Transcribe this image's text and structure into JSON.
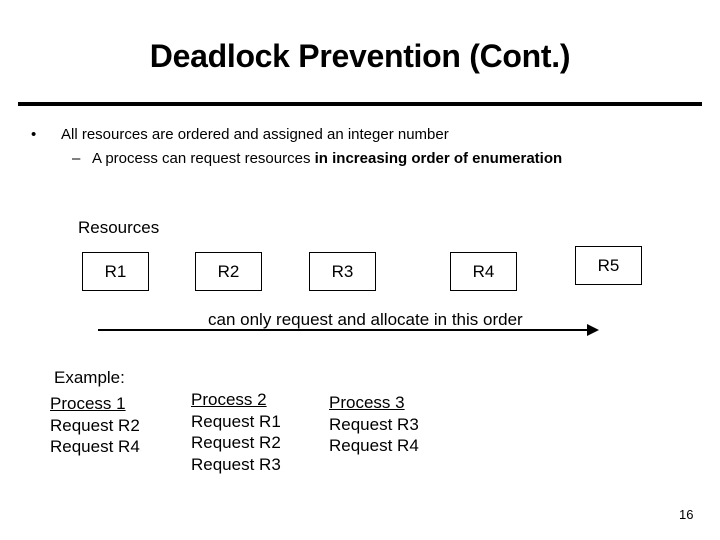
{
  "slide": {
    "title": "Deadlock Prevention (Cont.)",
    "bullets": [
      {
        "marker": "•",
        "text": "All resources are ordered and assigned an integer number",
        "sub": {
          "marker": "–",
          "text_plain": "A process can request resources ",
          "text_bold": "in increasing order of enumeration"
        }
      }
    ],
    "resources_label": "Resources",
    "resources": [
      "R1",
      "R2",
      "R3",
      "R4",
      "R5"
    ],
    "arrow_label": "can only request and allocate in this order",
    "example_label": "Example:",
    "processes": [
      {
        "name": "Process 1",
        "requests": [
          "Request R2",
          "Request R4"
        ]
      },
      {
        "name": "Process 2",
        "requests": [
          "Request R1",
          "Request R2",
          "Request R3"
        ]
      },
      {
        "name": "Process 3",
        "requests": [
          "Request R3",
          "Request R4"
        ]
      }
    ],
    "page_number": "16"
  }
}
